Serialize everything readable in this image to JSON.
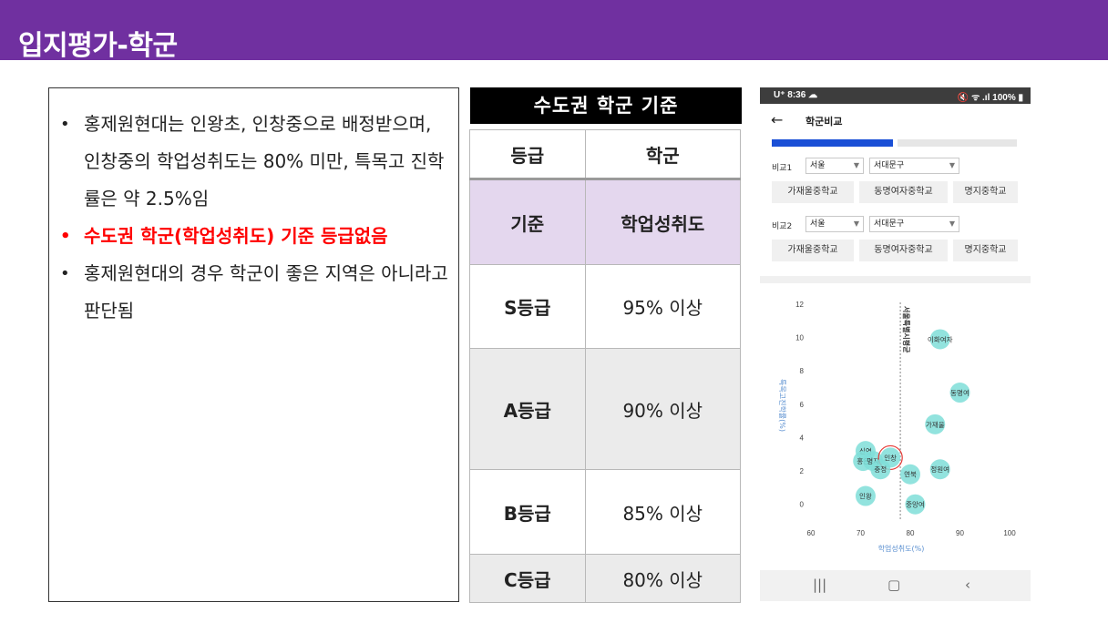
{
  "header": {
    "title": "입지평가-학군"
  },
  "bullets": [
    {
      "text": "홍제원현대는 인왕초, 인창중으로 배정받으며, 인창중의 학업성취도는 80% 미만, 특목고 진학률은 약 2.5%임",
      "highlight": false
    },
    {
      "text": "수도권 학군(학업성취도) 기준 등급없음",
      "highlight": true
    },
    {
      "text": "홍제원현대의 경우 학군이 좋은 지역은 아니라고 판단됨",
      "highlight": false
    }
  ],
  "grade_table": {
    "title": "수도권 학군 기준",
    "headers": [
      "등급",
      "학군"
    ],
    "basis": [
      "기준",
      "학업성취도"
    ],
    "rows": [
      {
        "grade": "S등급",
        "criterion": "95% 이상"
      },
      {
        "grade": "A등급",
        "criterion": "90% 이상"
      },
      {
        "grade": "B등급",
        "criterion": "85% 이상"
      },
      {
        "grade": "C등급",
        "criterion": "80% 이상"
      }
    ]
  },
  "phone": {
    "status_time": "U⁺ 8:36 ☁",
    "status_right": "🔇 ᯤ .ıl 100% ▮",
    "app_title": "학군비교",
    "compare1": {
      "label": "비교1",
      "region": "서울",
      "district": "서대문구",
      "schools": [
        "가재울중학교",
        "동명여자중학교",
        "명지중학교"
      ]
    },
    "compare2": {
      "label": "비교2",
      "region": "서울",
      "district": "서대문구",
      "schools": [
        "가재울중학교",
        "동명여자중학교",
        "명지중학교"
      ]
    },
    "colors": {
      "accent": "#1a4fd6",
      "bubble": "#7fded8",
      "axis_label": "#5a8fd0",
      "highlight_ring": "#e53935"
    }
  },
  "chart_data": {
    "type": "scatter",
    "xlabel": "학업성취도(%)",
    "ylabel": "특목고진학률(%)",
    "xlim": [
      60,
      100
    ],
    "ylim": [
      -1,
      12
    ],
    "xticks": [
      60,
      70,
      80,
      90,
      100
    ],
    "yticks": [
      0,
      2,
      4,
      6,
      8,
      10,
      12
    ],
    "reference_line": {
      "x": 78,
      "label": "서울특별시평균"
    },
    "points": [
      {
        "name": "이화여자",
        "x": 86,
        "y": 9.9
      },
      {
        "name": "동명여",
        "x": 90,
        "y": 6.7
      },
      {
        "name": "가재울",
        "x": 85,
        "y": 4.8
      },
      {
        "name": "신연",
        "x": 71,
        "y": 3.2
      },
      {
        "name": "홍은",
        "x": 70.5,
        "y": 2.6
      },
      {
        "name": "명지",
        "x": 72.5,
        "y": 2.6
      },
      {
        "name": "인창",
        "x": 76,
        "y": 2.8,
        "highlight": true
      },
      {
        "name": "충정",
        "x": 74,
        "y": 2.1
      },
      {
        "name": "연북",
        "x": 80,
        "y": 1.8
      },
      {
        "name": "정원여",
        "x": 86,
        "y": 2.1
      },
      {
        "name": "인왕",
        "x": 71,
        "y": 0.5
      },
      {
        "name": "중앙여",
        "x": 81,
        "y": 0
      }
    ]
  }
}
